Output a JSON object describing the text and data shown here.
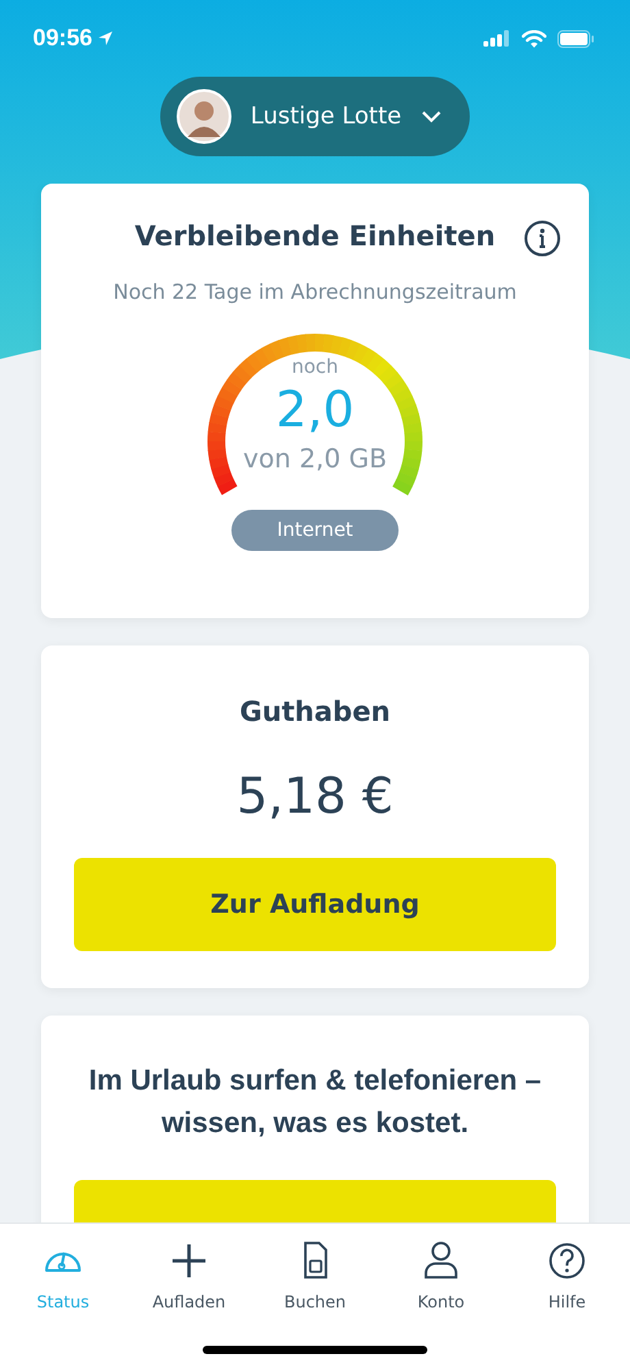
{
  "status_bar": {
    "time": "09:56"
  },
  "profile": {
    "name": "Lustige Lotte"
  },
  "units_card": {
    "title": "Verbleibende Einheiten",
    "period": "Noch 22 Tage im Abrechnungszeitraum",
    "gauge": {
      "prefix": "noch",
      "value": "2,0",
      "total": "von 2,0 GB"
    },
    "category": "Internet"
  },
  "balance_card": {
    "title": "Guthaben",
    "amount": "5,18 €",
    "button": "Zur Aufladung"
  },
  "roaming_card": {
    "text": "Im Urlaub surfen & telefonieren – wissen, was es kostet."
  },
  "tabs": [
    {
      "label": "Status",
      "kind": "gauge",
      "selected": true
    },
    {
      "label": "Aufladen",
      "kind": "plus",
      "selected": false
    },
    {
      "label": "Buchen",
      "kind": "sim",
      "selected": false
    },
    {
      "label": "Konto",
      "kind": "person",
      "selected": false
    },
    {
      "label": "Hilfe",
      "kind": "help",
      "selected": false
    }
  ]
}
